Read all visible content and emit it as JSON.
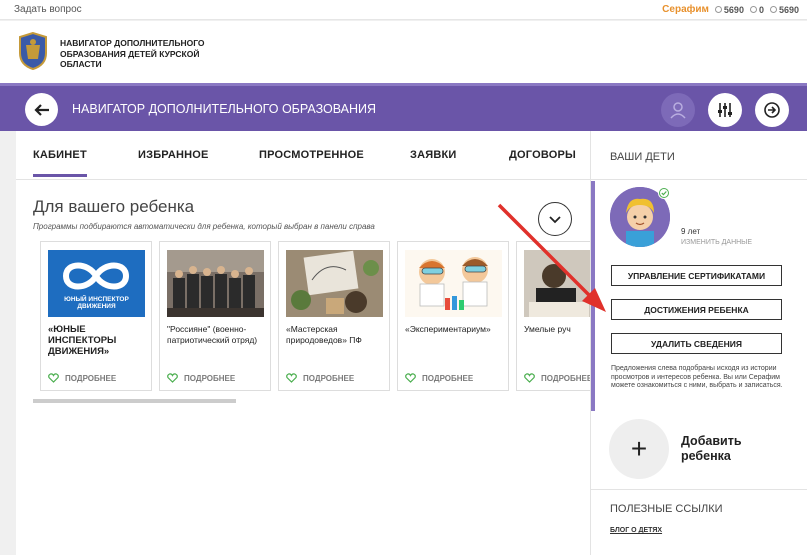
{
  "topbar": {
    "ask": "Задать вопрос",
    "user": "Серафим",
    "stat1": "5690",
    "stat2": "0",
    "stat3": "5690"
  },
  "brand": {
    "title": "НАВИГАТОР ДОПОЛНИТЕЛЬНОГО ОБРАЗОВАНИЯ ДЕТЕЙ КУРСКОЙ ОБЛАСТИ",
    "logo_icon": "coat-of-arms"
  },
  "navbar": {
    "title": "НАВИГАТОР ДОПОЛНИТЕЛЬНОГО ОБРАЗОВАНИЯ"
  },
  "tabs": [
    {
      "label": "КАБИНЕТ"
    },
    {
      "label": "ИЗБРАННОЕ"
    },
    {
      "label": "ПРОСМОТРЕННОЕ"
    },
    {
      "label": "ЗАЯВКИ"
    },
    {
      "label": "ДОГОВОРЫ"
    }
  ],
  "section": {
    "title": "Для вашего ребенка",
    "subtitle": "Программы подбираются автоматически для ребенка, который выбран в панели справа"
  },
  "cards": [
    {
      "title": "«ЮНЫЕ ИНСПЕКТОРЫ ДВИЖЕНИЯ»",
      "more": "ПОДРОБНЕЕ",
      "logo_text": "ЮНЫЙ ИНСПЕКТОР ДВИЖЕНИЯ"
    },
    {
      "title": "\"Россияне\" (военно-патриотический отряд)",
      "more": "ПОДРОБНЕЕ"
    },
    {
      "title": "«Мастерская природоведов» ПФ",
      "more": "ПОДРОБНЕЕ"
    },
    {
      "title": "«Экспериментариум»",
      "more": "ПОДРОБНЕЕ"
    },
    {
      "title": "Умелые руч",
      "more": "ПОДРОБНЕЕ"
    }
  ],
  "side": {
    "kids_head": "ВАШИ ДЕТИ",
    "age": "9 лет",
    "edit": "ИЗМЕНИТЬ ДАННЫЕ",
    "btn_certs": "УПРАВЛЕНИЕ СЕРТИФИКАТАМИ",
    "btn_achievements": "ДОСТИЖЕНИЯ РЕБЕНКА",
    "btn_delete": "УДАЛИТЬ СВЕДЕНИЯ",
    "note": "Предложения слева подобраны исходя из истории просмотров и интересов ребенка. Вы или Серафим можете ознакомиться с ними, выбрать и записаться.",
    "add_child": "Добавить ребенка",
    "links_head": "ПОЛЕЗНЫЕ ССЫЛКИ",
    "link_blog": "БЛОГ О ДЕТЯХ"
  },
  "colors": {
    "accent": "#6a55a8",
    "user": "#e8912d",
    "arrow": "#e0312b",
    "like": "#4caf50"
  }
}
